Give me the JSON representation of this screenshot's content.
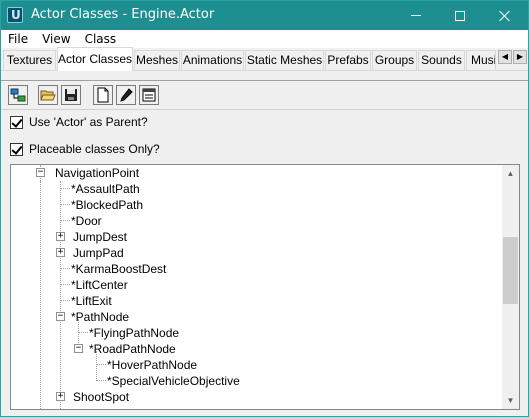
{
  "window": {
    "title": "Actor Classes - Engine.Actor"
  },
  "menu": [
    "File",
    "View",
    "Class"
  ],
  "tabs": [
    "Textures",
    "Actor Classes",
    "Meshes",
    "Animations",
    "Static Meshes",
    "Prefabs",
    "Groups",
    "Sounds",
    "Music"
  ],
  "active_tab": "Actor Classes",
  "toolbar": [
    "actor-class-tree-icon",
    "open-folder-icon",
    "save-icon",
    "new-document-icon",
    "edit-pencil-icon",
    "properties-icon"
  ],
  "options": {
    "use_actor_parent": {
      "label": "Use 'Actor' as Parent?",
      "checked": true
    },
    "placeable_only": {
      "label": "Placeable classes Only?",
      "checked": true
    }
  },
  "tree": {
    "nodes": [
      "NavigationPoint",
      "*AssaultPath",
      "*BlockedPath",
      "*Door",
      "JumpDest",
      "JumpPad",
      "*KarmaBoostDest",
      "*LiftCenter",
      "*LiftExit",
      "*PathNode",
      "*FlyingPathNode",
      "*RoadPathNode",
      "*HoverPathNode",
      "*SpecialVehicleObjective",
      "ShootSpot"
    ]
  }
}
